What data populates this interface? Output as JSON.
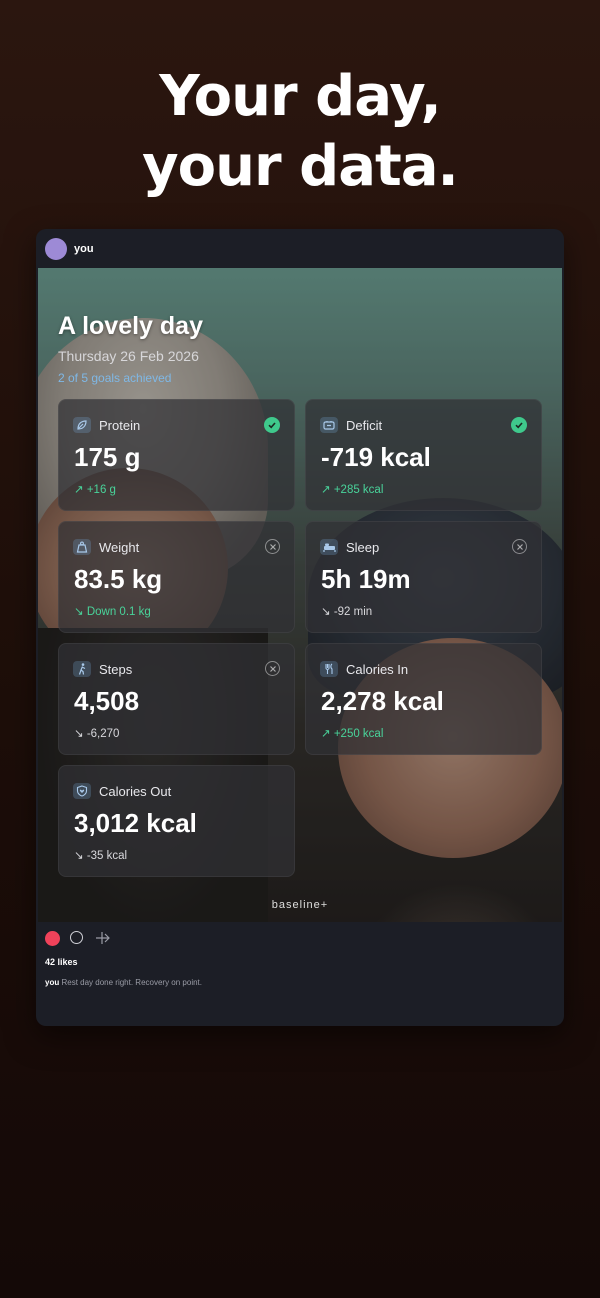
{
  "headline": {
    "line1": "Your day,",
    "line2": "your data."
  },
  "post": {
    "username": "you",
    "day_title": "A lovely day",
    "date": "Thursday 26 Feb 2026",
    "goals_summary": "2 of 5 goals achieved",
    "watermark": "baseline+",
    "likes": "42 likes",
    "caption_user": "you",
    "caption_text": "Rest day done right. Recovery on point."
  },
  "tiles": [
    {
      "label": "Protein",
      "value": "175 g",
      "delta": "↗ +16 g",
      "status": "achieved",
      "icon": "leaf-icon"
    },
    {
      "label": "Deficit",
      "value": "-719 kcal",
      "delta": "↗ +285 kcal",
      "status": "achieved",
      "icon": "battery-icon"
    },
    {
      "label": "Weight",
      "value": "83.5 kg",
      "delta": "↘ Down 0.1 kg",
      "status": "missed",
      "icon": "weight-icon"
    },
    {
      "label": "Sleep",
      "value": "5h 19m",
      "delta": "↘ -92 min",
      "status": "missed",
      "icon": "bed-icon"
    },
    {
      "label": "Steps",
      "value": "4,508",
      "delta": "↘ -6,270",
      "status": "missed",
      "icon": "walking-icon"
    },
    {
      "label": "Calories In",
      "value": "2,278 kcal",
      "delta": "↗ +250 kcal",
      "status": "none",
      "icon": "fork-knife-icon"
    },
    {
      "label": "Calories Out",
      "value": "3,012 kcal",
      "delta": "↘ -35 kcal",
      "status": "none",
      "icon": "heart-shield-icon"
    }
  ],
  "colors": {
    "accent_green": "#49d39a",
    "goal_blue": "#7fb8e6",
    "like_red": "#f0425a",
    "avatar": "#9d8ad6"
  }
}
